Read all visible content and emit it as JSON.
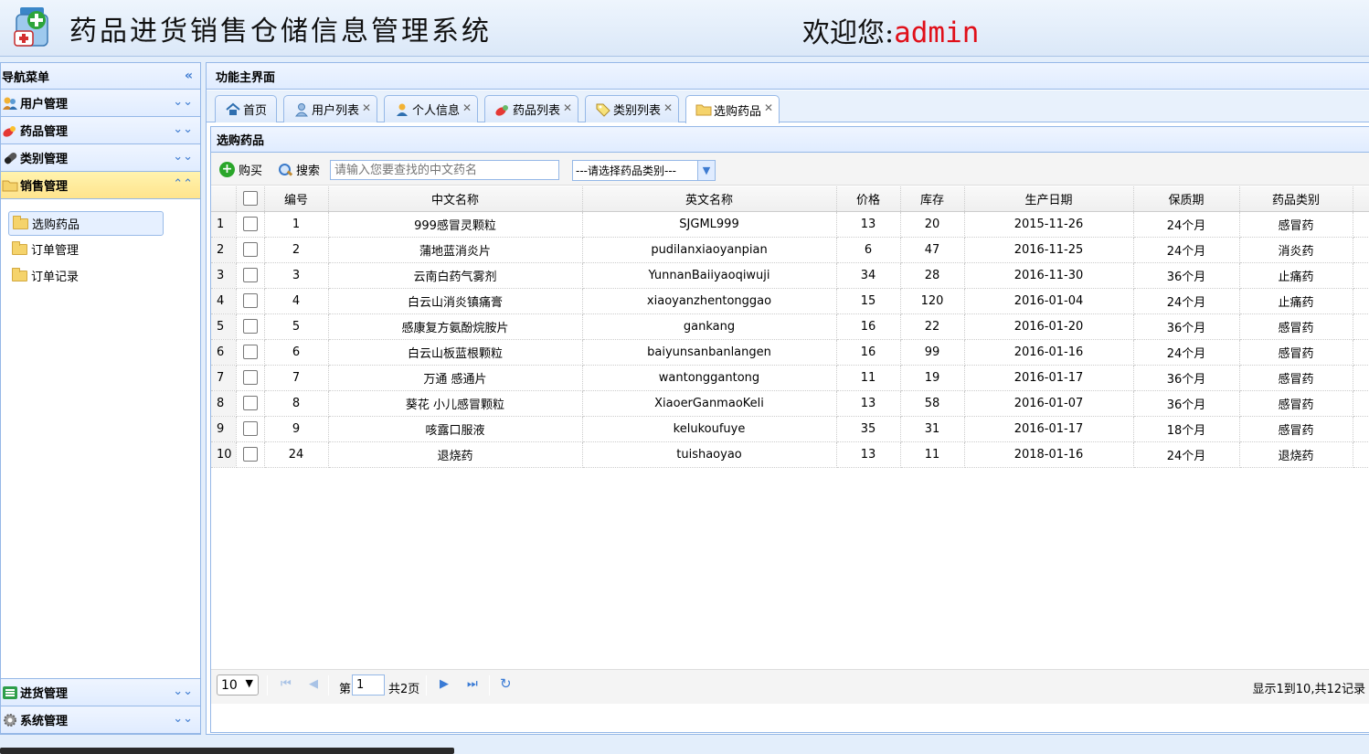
{
  "header": {
    "title": "药品进货销售仓储信息管理系统",
    "welcome_label": "欢迎您:",
    "username": "admin"
  },
  "sidebar": {
    "title": "导航菜单",
    "menus": [
      {
        "label": "用户管理",
        "icon": "users-icon"
      },
      {
        "label": "药品管理",
        "icon": "pill-icon"
      },
      {
        "label": "类别管理",
        "icon": "capsule-icon"
      },
      {
        "label": "销售管理",
        "icon": "folder-icon",
        "active": true
      }
    ],
    "sales_items": [
      "选购药品",
      "订单管理",
      "订单记录"
    ],
    "bottom_menus": [
      {
        "label": "进货管理",
        "icon": "list-icon"
      },
      {
        "label": "系统管理",
        "icon": "gear-icon"
      }
    ]
  },
  "main": {
    "title": "功能主界面",
    "tabs": [
      {
        "label": "首页",
        "icon": "home-icon",
        "closable": false
      },
      {
        "label": "用户列表",
        "icon": "users-icon",
        "closable": true
      },
      {
        "label": "个人信息",
        "icon": "user-icon",
        "closable": true
      },
      {
        "label": "药品列表",
        "icon": "pill-icon",
        "closable": true
      },
      {
        "label": "类别列表",
        "icon": "tag-icon",
        "closable": true
      },
      {
        "label": "选购药品",
        "icon": "folder-icon",
        "closable": true,
        "active": true
      }
    ],
    "panel_title": "选购药品",
    "toolbar": {
      "buy_label": "购买",
      "search_label": "搜索",
      "search_placeholder": "请输入您要查找的中文药名",
      "category_select": "---请选择药品类别---"
    },
    "grid": {
      "columns": [
        "编号",
        "中文名称",
        "英文名称",
        "价格",
        "库存",
        "生产日期",
        "保质期",
        "药品类别"
      ],
      "rows": [
        [
          "1",
          "999感冒灵颗粒",
          "SJGML999",
          "13",
          "20",
          "2015-11-26",
          "24个月",
          "感冒药"
        ],
        [
          "2",
          "蒲地蓝消炎片",
          "pudilanxiaoyanpian",
          "6",
          "47",
          "2016-11-25",
          "24个月",
          "消炎药"
        ],
        [
          "3",
          "云南白药气雾剂",
          "YunnanBaiiyaoqiwuji",
          "34",
          "28",
          "2016-11-30",
          "36个月",
          "止痛药"
        ],
        [
          "4",
          "白云山消炎镇痛膏",
          "xiaoyanzhentonggao",
          "15",
          "120",
          "2016-01-04",
          "24个月",
          "止痛药"
        ],
        [
          "5",
          "感康复方氨酚烷胺片",
          "gankang",
          "16",
          "22",
          "2016-01-20",
          "36个月",
          "感冒药"
        ],
        [
          "6",
          "白云山板蓝根颗粒",
          "baiyunsanbanlangen",
          "16",
          "99",
          "2016-01-16",
          "24个月",
          "感冒药"
        ],
        [
          "7",
          "万通 感通片",
          "wantonggantong",
          "11",
          "19",
          "2016-01-17",
          "36个月",
          "感冒药"
        ],
        [
          "8",
          "葵花 小儿感冒颗粒",
          "XiaoerGanmaoKeli",
          "13",
          "58",
          "2016-01-07",
          "36个月",
          "感冒药"
        ],
        [
          "9",
          "咳露口服液",
          "kelukoufuye",
          "35",
          "31",
          "2016-01-17",
          "18个月",
          "感冒药"
        ],
        [
          "24",
          "退烧药",
          "tuishaoyao",
          "13",
          "11",
          "2018-01-16",
          "24个月",
          "退烧药"
        ]
      ]
    },
    "pager": {
      "page_size": "10",
      "page_prefix": "第",
      "current_page": "1",
      "total_pages": "共2页",
      "info": "显示1到10,共12记录"
    }
  },
  "colors": {
    "accent": "#95b8e7",
    "username": "#e0101a",
    "active_menu": "#ffe48d"
  }
}
